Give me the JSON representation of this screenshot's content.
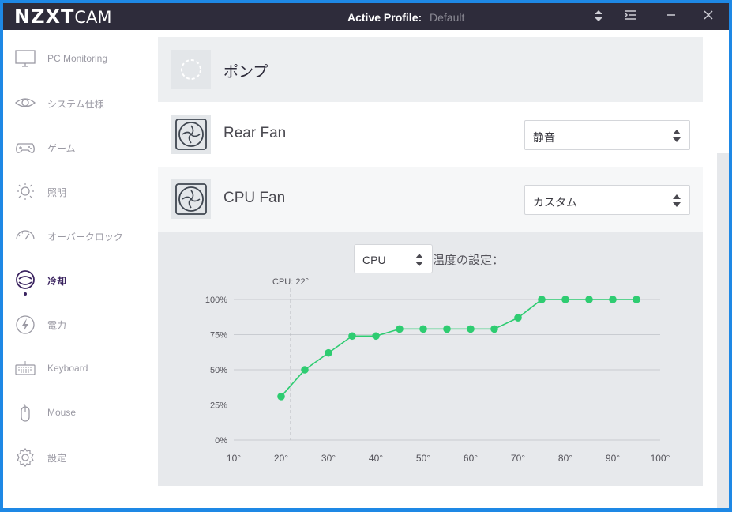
{
  "titlebar": {
    "logo_main": "NZXT",
    "logo_sub": "CAM",
    "profile_label": "Active Profile:",
    "profile_value": "Default"
  },
  "sidebar": {
    "items": [
      {
        "label": "PC Monitoring",
        "icon": "monitor-icon"
      },
      {
        "label": "システム仕様",
        "icon": "eye-icon"
      },
      {
        "label": "ゲーム",
        "icon": "gamepad-icon"
      },
      {
        "label": "照明",
        "icon": "sun-icon"
      },
      {
        "label": "オーバークロック",
        "icon": "gauge-icon"
      },
      {
        "label": "冷却",
        "icon": "cooling-icon",
        "active": true
      },
      {
        "label": "電力",
        "icon": "bolt-icon"
      },
      {
        "label": "Keyboard",
        "icon": "keyboard-icon"
      },
      {
        "label": "Mouse",
        "icon": "mouse-icon"
      },
      {
        "label": "設定",
        "icon": "gear-icon"
      }
    ]
  },
  "devices": {
    "pump": {
      "name": "ポンプ"
    },
    "rear_fan": {
      "name": "Rear Fan",
      "mode": "静音"
    },
    "cpu_fan": {
      "name": "CPU Fan",
      "mode": "カスタム"
    }
  },
  "curve": {
    "source": "CPU",
    "label": "温度の設定："
  },
  "colors": {
    "accent": "#2ecc71",
    "active_nav": "#3b2460",
    "titlebar": "#2e2c3b"
  },
  "chart_data": {
    "type": "line",
    "marker_label": "CPU: 22°",
    "marker_x": 22,
    "x": [
      20,
      25,
      30,
      35,
      40,
      45,
      50,
      55,
      60,
      65,
      70,
      75,
      80,
      85,
      90,
      95
    ],
    "series": [
      {
        "values": [
          31,
          50,
          62,
          74,
          74,
          79,
          79,
          79,
          79,
          79,
          87,
          100,
          100,
          100,
          100,
          100
        ]
      }
    ],
    "x_ticks": [
      "10°",
      "20°",
      "30°",
      "40°",
      "50°",
      "60°",
      "70°",
      "80°",
      "90°",
      "100°"
    ],
    "x_tick_values": [
      10,
      20,
      30,
      40,
      50,
      60,
      70,
      80,
      90,
      100
    ],
    "y_ticks": [
      "0%",
      "25%",
      "50%",
      "75%",
      "100%"
    ],
    "y_tick_values": [
      0,
      25,
      50,
      75,
      100
    ],
    "xlim": [
      10,
      100
    ],
    "ylim": [
      0,
      100
    ],
    "grid": true
  }
}
